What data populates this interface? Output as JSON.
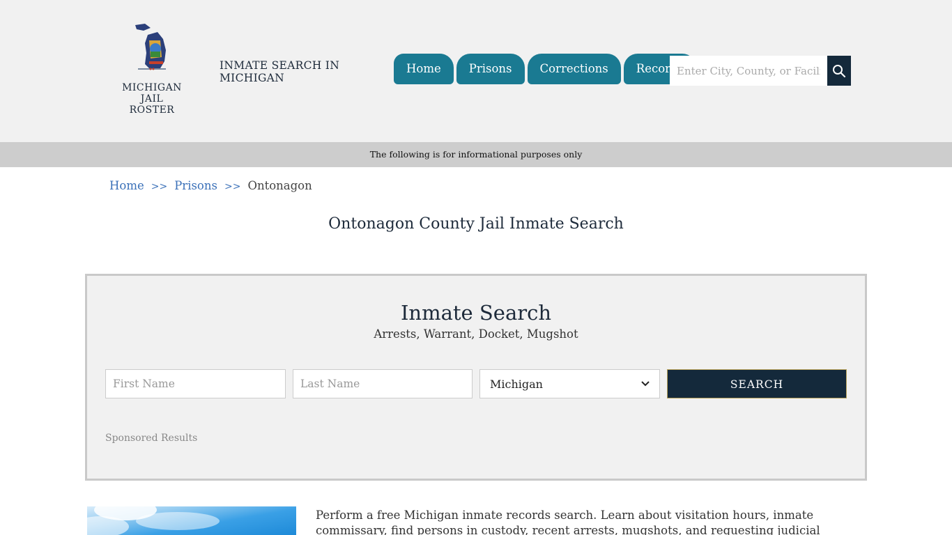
{
  "header": {
    "logo_text_line1": "MICHIGAN",
    "logo_text_line2": "JAIL ROSTER",
    "site_title": "INMATE SEARCH IN MICHIGAN",
    "nav": [
      {
        "label": "Home"
      },
      {
        "label": "Prisons"
      },
      {
        "label": "Corrections"
      },
      {
        "label": "Records"
      }
    ],
    "search_placeholder": "Enter City, County, or Facility"
  },
  "info_bar": "The following is for informational purposes only",
  "breadcrumb": {
    "items": [
      "Home",
      "Prisons"
    ],
    "separator": ">>",
    "current": "Ontonagon"
  },
  "page_title": "Ontonagon County Jail Inmate Search",
  "search_panel": {
    "title": "Inmate Search",
    "subtitle": "Arrests, Warrant, Docket, Mugshot",
    "first_name_placeholder": "First Name",
    "last_name_placeholder": "Last Name",
    "state_selected": "Michigan",
    "search_label": "SEARCH",
    "sponsored_label": "Sponsored Results"
  },
  "intro_text": "Perform a free Michigan inmate records search. Learn about visitation hours, inmate commissary, find persons in custody, recent arrests, mugshots, and requesting judicial records.",
  "colors": {
    "nav_bg": "#1a7a92",
    "dark_navy": "#14293b",
    "link_blue": "#3a70b8",
    "header_bg": "#f1f1f1",
    "info_bar_bg": "#cdcdcd"
  }
}
